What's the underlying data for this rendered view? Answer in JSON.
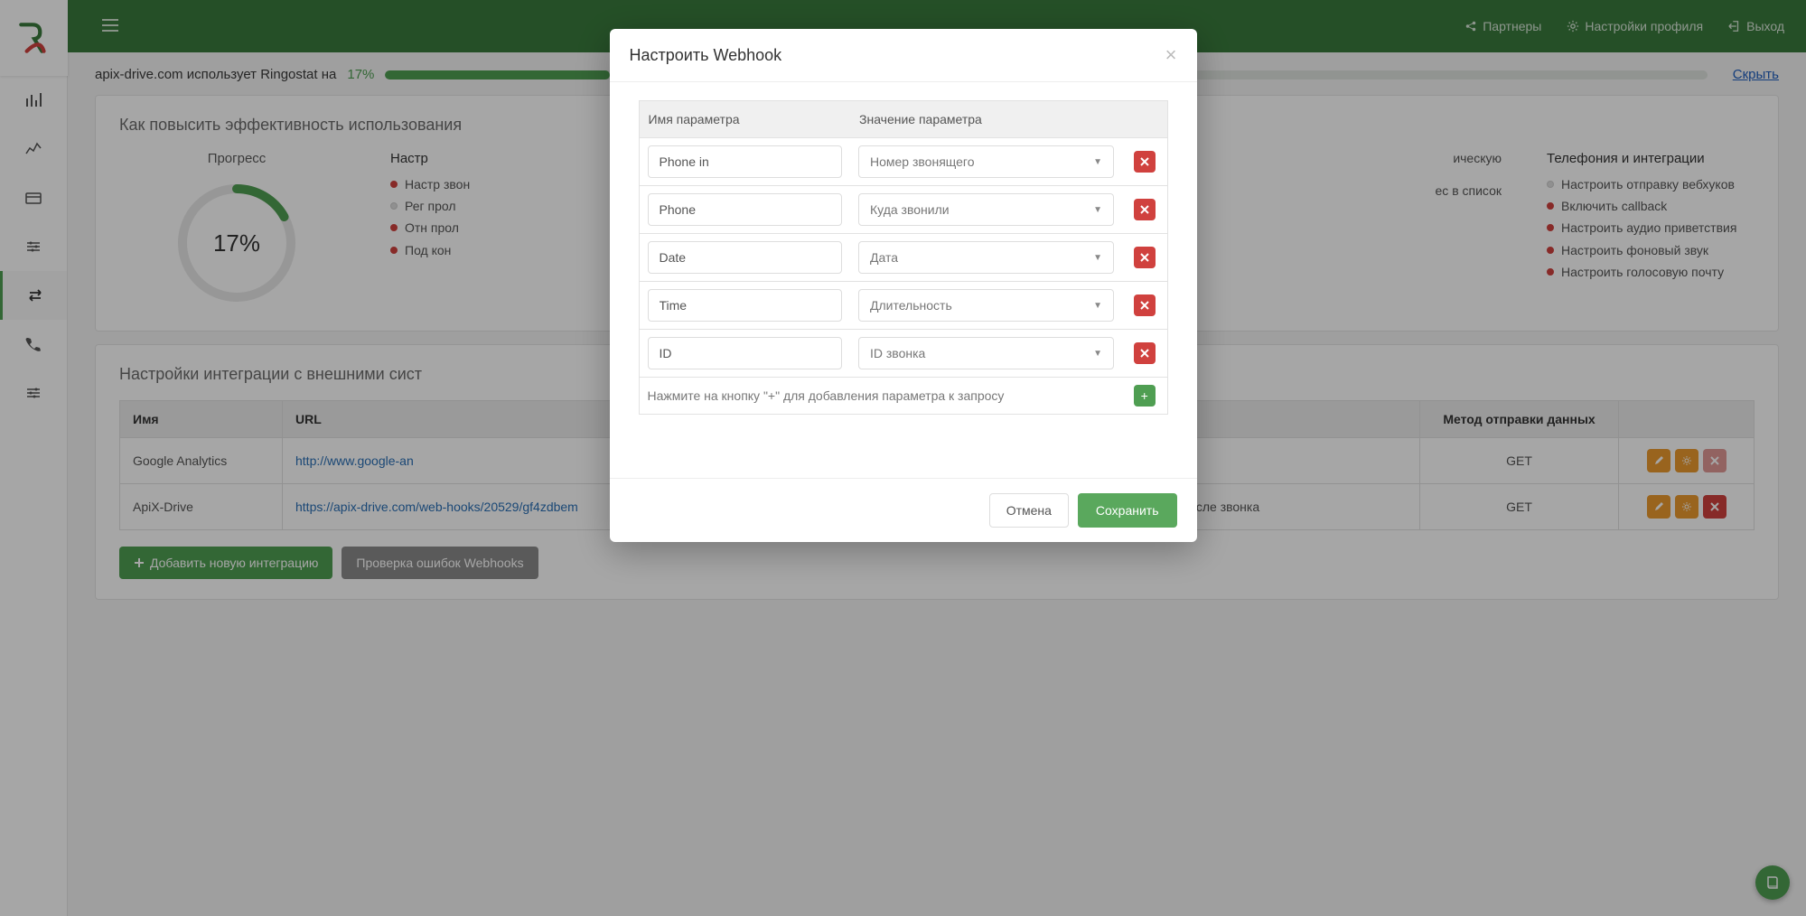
{
  "top": {
    "partners": "Партнеры",
    "profile": "Настройки профиля",
    "logout": "Выход"
  },
  "usage": {
    "text": "apix-drive.com использует Ringostat на",
    "percent": "17%",
    "hide": "Скрыть"
  },
  "eff": {
    "title": "Как повысить эффективность использования",
    "progress_label": "Прогресс",
    "progress_value": "17%",
    "col2_title": "Настр",
    "col2_items": [
      {
        "state": "todo",
        "text": "Настр звон"
      },
      {
        "state": "neutral",
        "text": "Рег прол"
      },
      {
        "state": "todo",
        "text": "Отн прол"
      },
      {
        "state": "todo",
        "text": "Под кон"
      }
    ],
    "col3_title": "Телефония и интеграции",
    "col3_items": [
      {
        "state": "neutral",
        "text": "Настроить отправку вебхуков"
      },
      {
        "state": "todo",
        "text": "Включить callback"
      },
      {
        "state": "todo",
        "text": "Настроить аудио приветствия"
      },
      {
        "state": "todo",
        "text": "Настроить фоновый звук"
      },
      {
        "state": "todo",
        "text": "Настроить голосовую почту"
      }
    ],
    "mid_fragment1": "ическую",
    "mid_fragment2": "ес в список"
  },
  "integrations": {
    "title": "Настройки интеграции с внешними сист",
    "headers": {
      "name": "Имя",
      "url": "URL",
      "event": "",
      "method": "Метод отправки данных",
      "actions": ""
    },
    "rows": [
      {
        "name": "Google Analytics",
        "url": "http://www.google-an",
        "event": "",
        "method": "GET",
        "can_delete": false
      },
      {
        "name": "ApiX-Drive",
        "url": "https://apix-drive.com/web-hooks/20529/gf4zdbem",
        "event": "После звонка",
        "method": "GET",
        "can_delete": true
      }
    ],
    "add_btn": "Добавить новую интеграцию",
    "check_btn": "Проверка ошибок Webhooks"
  },
  "modal": {
    "title": "Настроить Webhook",
    "col_name": "Имя параметра",
    "col_value": "Значение параметра",
    "params": [
      {
        "name": "Phone in",
        "value": "Номер звонящего"
      },
      {
        "name": "Phone",
        "value": "Куда звонили"
      },
      {
        "name": "Date",
        "value": "Дата"
      },
      {
        "name": "Time",
        "value": "Длительность"
      },
      {
        "name": "ID",
        "value": "ID звонка"
      }
    ],
    "hint": "Нажмите на кнопку \"+\" для добавления параметра к запросу",
    "cancel": "Отмена",
    "save": "Сохранить"
  }
}
